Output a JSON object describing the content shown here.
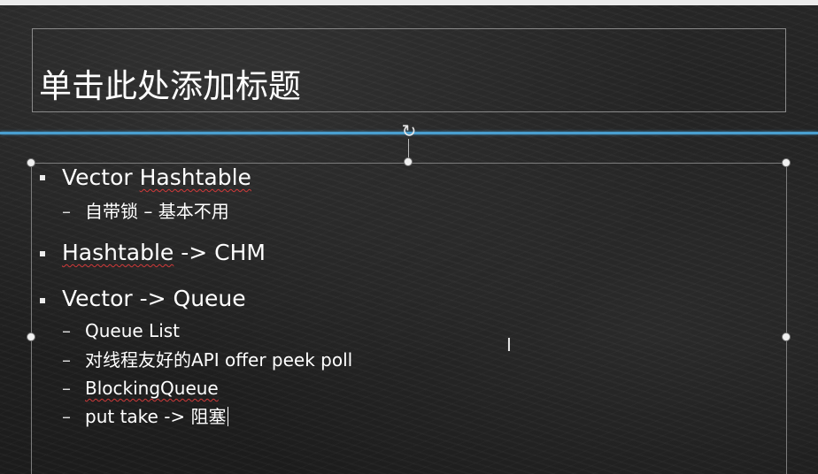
{
  "slide": {
    "title": "单击此处添加标题",
    "accent_color": "#4a9fd0",
    "items": [
      {
        "label_parts": [
          "Vector ",
          "Hashtable"
        ],
        "sub": [
          "自带锁 – 基本不用"
        ]
      },
      {
        "label_parts": [
          "Hashtable",
          " -> CHM"
        ]
      },
      {
        "label_parts": [
          "Vector -> Queue"
        ],
        "sub": [
          "Queue List",
          "对线程友好的API offer peek poll",
          "BlockingQueue",
          "put take -> 阻塞"
        ]
      }
    ],
    "dash": "–"
  },
  "icons": {
    "rotate": "rotate-handle-icon",
    "cursor": "text-cursor-icon"
  }
}
